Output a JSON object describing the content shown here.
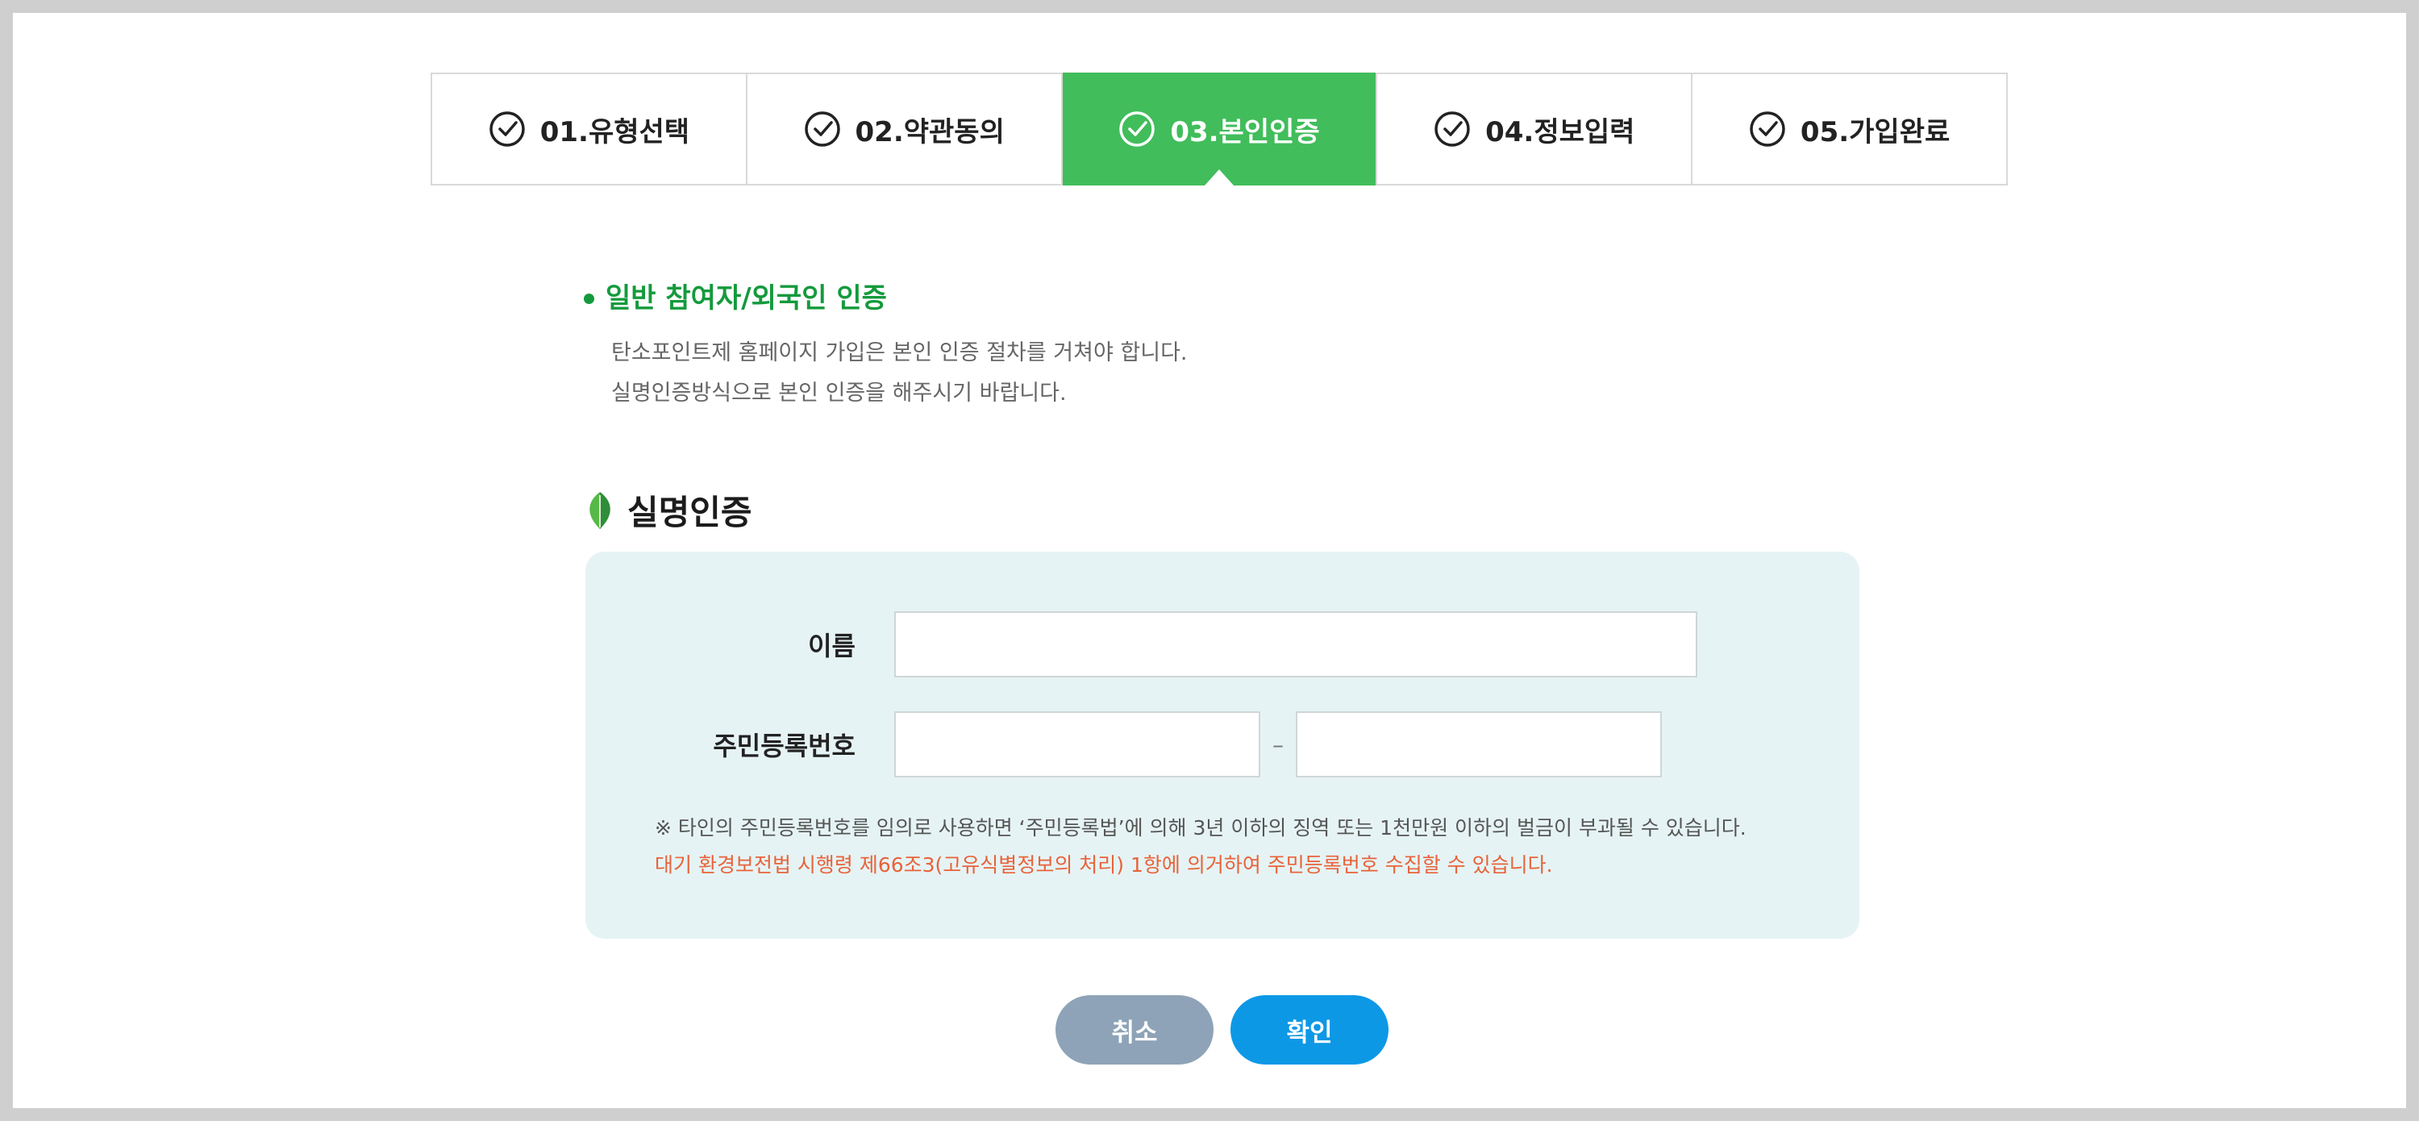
{
  "steps": [
    {
      "label": "01.유형선택",
      "active": false
    },
    {
      "label": "02.약관동의",
      "active": false
    },
    {
      "label": "03.본인인증",
      "active": true
    },
    {
      "label": "04.정보입력",
      "active": false
    },
    {
      "label": "05.가입완료",
      "active": false
    }
  ],
  "intro": {
    "title": "일반 참여자/외국인 인증",
    "line1": "탄소포인트제 홈페이지 가입은 본인 인증 절차를 거쳐야 합니다.",
    "line2": "실명인증방식으로 본인 인증을 해주시기 바랍니다."
  },
  "section": {
    "title": "실명인증"
  },
  "form": {
    "name_label": "이름",
    "name_value": "",
    "rrn_label": "주민등록번호",
    "rrn_front_value": "",
    "rrn_separator": "–",
    "rrn_back_value": "",
    "note1": "※ 타인의 주민등록번호를 임의로 사용하면 ‘주민등록법’에 의해 3년 이하의 징역 또는 1천만원 이하의 벌금이 부과될 수 있습니다.",
    "note2": "대기 환경보전법 시행령 제66조3(고유식별정보의 처리) 1항에 의거하여 주민등록번호 수집할 수 있습니다."
  },
  "buttons": {
    "cancel": "취소",
    "confirm": "확인"
  },
  "colors": {
    "accent": "#41bd5b",
    "intro_title": "#149a3c",
    "form_bg": "#e6f3f4",
    "notice": "#e8633a",
    "cancel": "#8ea3b7",
    "confirm": "#0d98e6"
  },
  "icons": {
    "step": "check-circle-icon",
    "section": "leaf-icon"
  }
}
